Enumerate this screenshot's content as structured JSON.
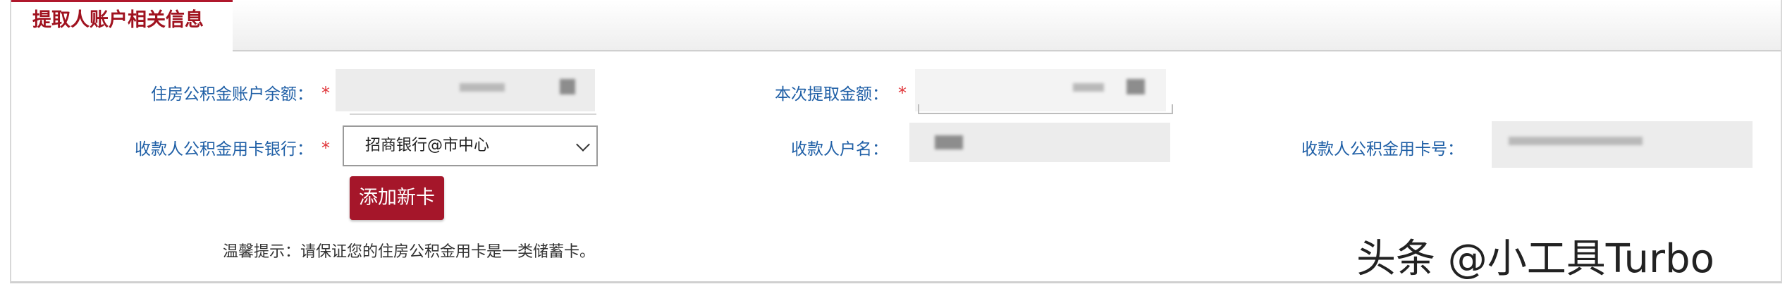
{
  "section": {
    "tab_title": "提取人账户相关信息"
  },
  "form": {
    "balance_label": "住房公积金账户余额：",
    "amount_label": "本次提取金额：",
    "bank_label": "收款人公积金用卡银行：",
    "account_name_label": "收款人户名：",
    "card_number_label": "收款人公积金用卡号：",
    "required_mark": "*",
    "bank_selected": "招商银行@市中心",
    "add_card_button": "添加新卡"
  },
  "tip": {
    "text": "温馨提示：请保证您的住房公积金用卡是一类储蓄卡。"
  },
  "watermark": {
    "text": "头条 @小工具Turbo"
  },
  "colors": {
    "accent": "#a5162a",
    "label": "#1f5fa6",
    "required": "#e0353a"
  }
}
